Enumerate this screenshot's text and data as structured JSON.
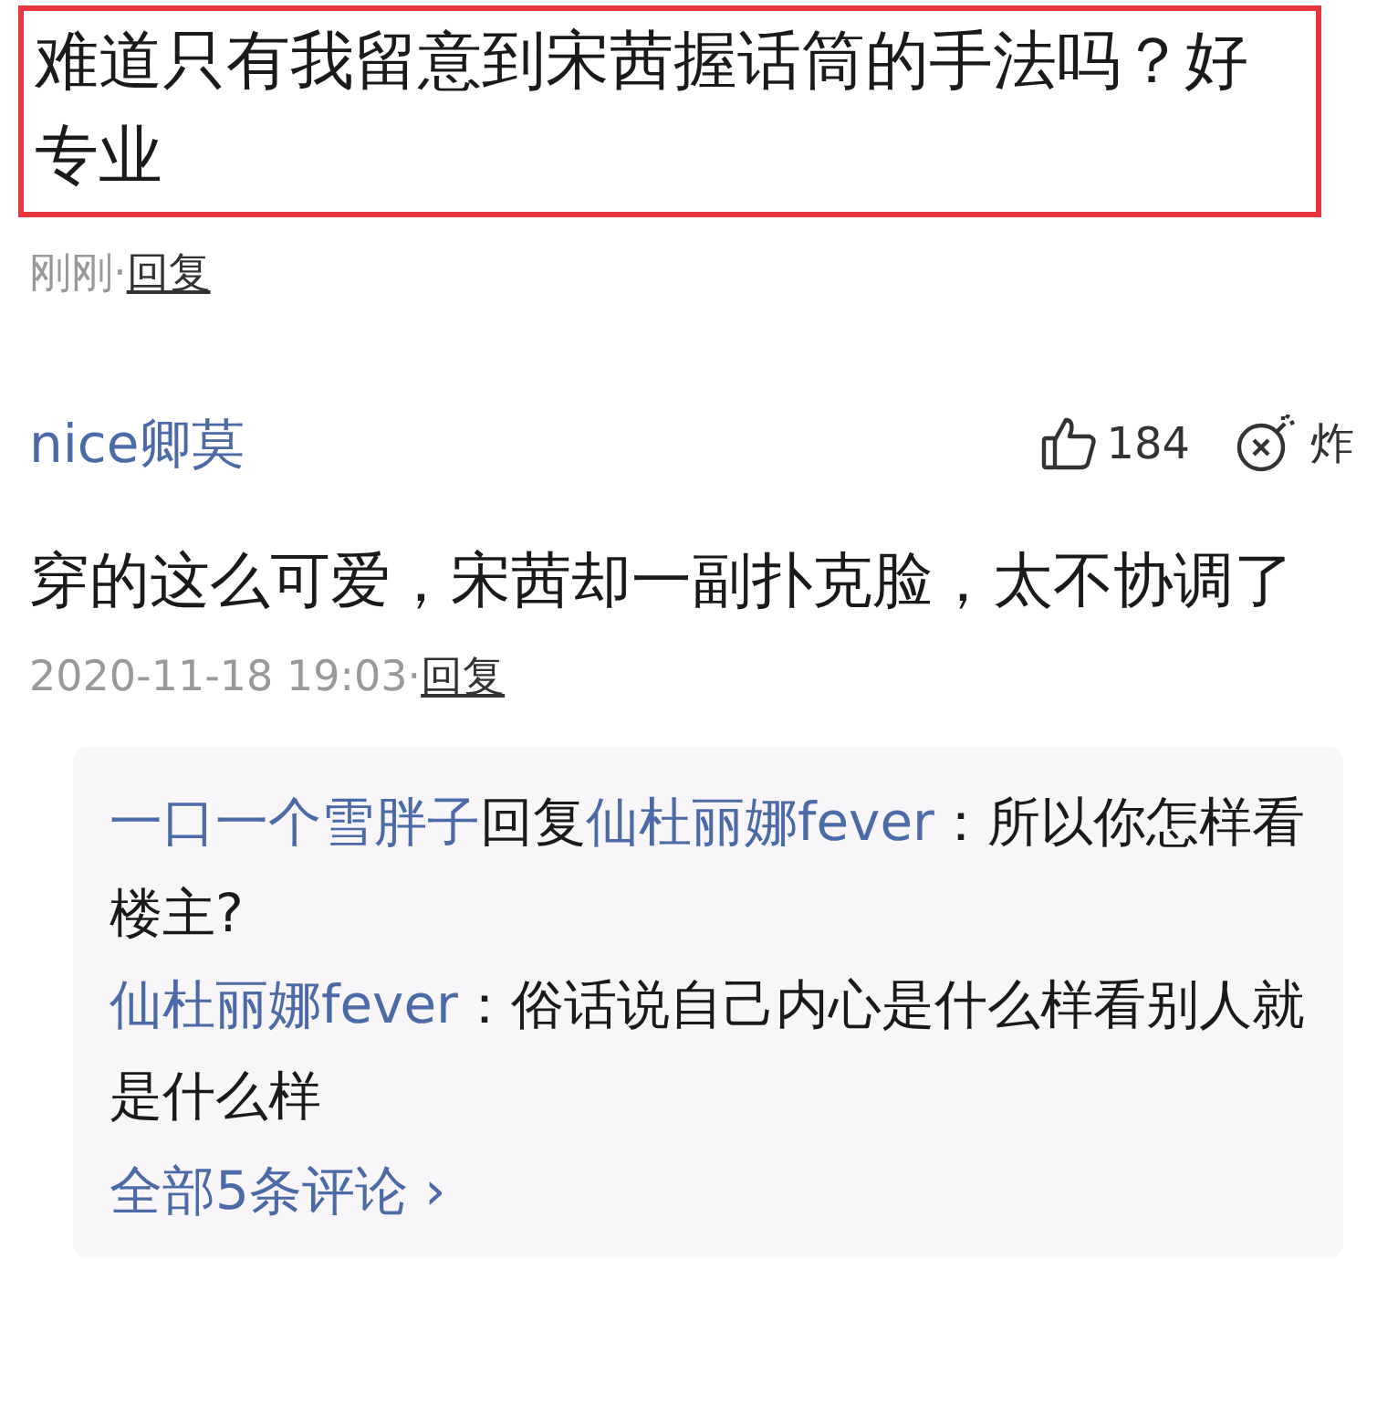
{
  "top_comment": {
    "text": "难道只有我留意到宋茜握话筒的手法吗？好专业",
    "highlighted": true,
    "time": "刚刚",
    "separator": "·",
    "reply_label": "回复"
  },
  "comment": {
    "author": "nice卿莫",
    "likes": "184",
    "bomb_label": "炸",
    "text": "穿的这么可爱，宋茜却一副扑克脸，太不协调了",
    "time": "2020-11-18 19:03",
    "separator": "·",
    "reply_label": "回复"
  },
  "replies": [
    {
      "author": "一口一个雪胖子",
      "reply_word": "回复",
      "target": "仙杜丽娜fever",
      "text": "：所以你怎样看楼主?"
    },
    {
      "author": "仙杜丽娜fever",
      "text": "：俗话说自己内心是什么样看别人就是什么样"
    }
  ],
  "more_link": {
    "label": "全部5条评论",
    "chevron": "›"
  }
}
